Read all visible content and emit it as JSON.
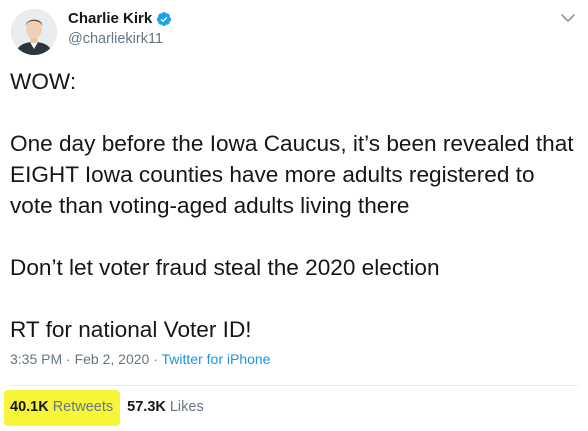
{
  "author": {
    "display_name": "Charlie Kirk",
    "handle": "@charliekirk11",
    "verified": true,
    "avatar_icon": "avatar-photo"
  },
  "tweet": {
    "lines": [
      "WOW:",
      "",
      "One day before the Iowa Caucus, it’s been revealed that",
      "EIGHT Iowa counties have more adults registered to",
      "vote than voting-aged adults living there",
      "",
      "Don’t let voter fraud steal the 2020 election",
      "",
      "RT for national Voter ID!"
    ]
  },
  "meta": {
    "time": "3:35 PM",
    "separator": " · ",
    "date": "Feb 2, 2020",
    "source": "Twitter for iPhone"
  },
  "stats": {
    "retweets_count": "40.1K",
    "retweets_label": "Retweets",
    "likes_count": "57.3K",
    "likes_label": "Likes"
  },
  "colors": {
    "text": "#14171a",
    "muted": "#657786",
    "link": "#1b95e0",
    "verified_badge": "#1da1f2",
    "highlight": "#f7f53a"
  }
}
